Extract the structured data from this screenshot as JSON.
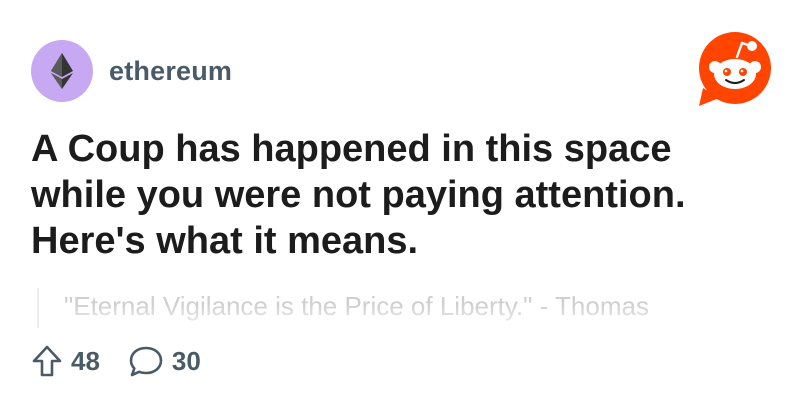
{
  "post": {
    "subreddit": "ethereum",
    "title": "A Coup has happened in this space while you were not paying attention. Here's what it means.",
    "body_preview": "\"Eternal Vigilance is the Price of Liberty.\" - Thomas",
    "upvotes": "48",
    "comments": "30"
  },
  "icons": {
    "subreddit_avatar": "ethereum-logo-icon",
    "brand_logo": "reddit-logo-icon",
    "upvote": "upvote-arrow-icon",
    "comment": "comment-bubble-icon"
  },
  "colors": {
    "avatar_bg": "#c6a9f2",
    "brand": "#ff4500",
    "meta_text": "#4a5a66",
    "title_text": "#1c1c1c",
    "quote_text": "#cfcfcf"
  }
}
